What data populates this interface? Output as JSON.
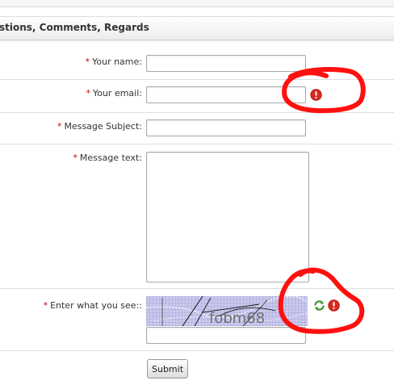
{
  "header": {
    "title": "stions, Comments, Regards"
  },
  "form": {
    "required_mark": "*",
    "fields": {
      "name": {
        "label": "Your name:",
        "value": ""
      },
      "email": {
        "label": "Your email:",
        "value": ""
      },
      "subject": {
        "label": "Message Subject:",
        "value": ""
      },
      "message": {
        "label": "Message text:",
        "value": ""
      },
      "captcha": {
        "label": "Enter what you see::",
        "value": "",
        "image_text": "fobm68"
      }
    },
    "submit_label": "Submit"
  },
  "icons": {
    "error": "error-icon",
    "refresh": "refresh-icon"
  },
  "colors": {
    "required": "#cc0000",
    "error_icon": "#d9281f",
    "refresh_icon": "#3a9a2a",
    "annotation": "#ff1010",
    "captcha_bg": "#c9c9ec"
  }
}
